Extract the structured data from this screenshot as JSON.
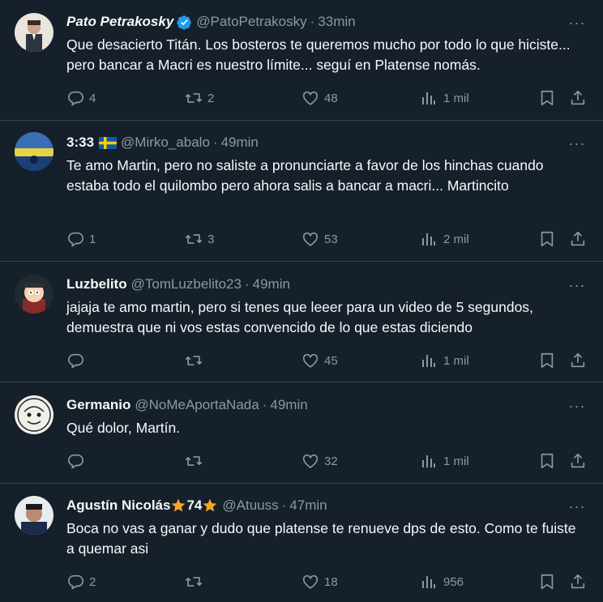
{
  "tweets": [
    {
      "name": "Pato Petrakosky",
      "handle": "@PatoPetrakosky",
      "dot": "·",
      "time": "33min",
      "verified": true,
      "text": "Que desacierto Titán. Los bosteros te queremos mucho por todo lo que hiciste... pero bancar a Macri es nuestro límite... seguí en Platense nomás.",
      "replies": "4",
      "retweets": "2",
      "likes": "48",
      "views": "1 mil"
    },
    {
      "name": "3:33",
      "handle": "@Mirko_abalo",
      "dot": "·",
      "time": "49min",
      "flag_emoji": "sweden-flag",
      "text": "Te amo Martin, pero no saliste a pronunciarte a favor de los hinchas cuando estaba todo el quilombo pero ahora salis a bancar a macri... Martincito",
      "replies": "1",
      "retweets": "3",
      "likes": "53",
      "views": "2 mil"
    },
    {
      "name": "Luzbelito",
      "handle": "@TomLuzbelito23",
      "dot": "·",
      "time": "49min",
      "text": "jajaja te amo martin, pero si tenes que leeer para un video de 5 segundos, demuestra que ni vos estas convencido de lo que estas diciendo",
      "replies": "",
      "retweets": "",
      "likes": "45",
      "views": "1 mil"
    },
    {
      "name": "Germanio",
      "handle": "@NoMeAportaNada",
      "dot": "·",
      "time": "49min",
      "text": "Qué dolor, Martín.",
      "replies": "",
      "retweets": "",
      "likes": "32",
      "views": "1 mil"
    },
    {
      "name": "Agustín Nicolás",
      "name_number": "74",
      "handle": "@Atuuss",
      "dot": "·",
      "time": "47min",
      "text": "Boca no vas a ganar y dudo que platense te renueve dps de esto. Como te fuiste a quemar asi",
      "replies": "2",
      "retweets": "",
      "likes": "18",
      "views": "956"
    }
  ],
  "more_label": "···",
  "colors": {
    "background": "#15202b",
    "divider": "#38444d",
    "text": "#f7f9f9",
    "muted": "#8b98a5",
    "verified": "#1d9bf0",
    "star": "#f5a623"
  }
}
